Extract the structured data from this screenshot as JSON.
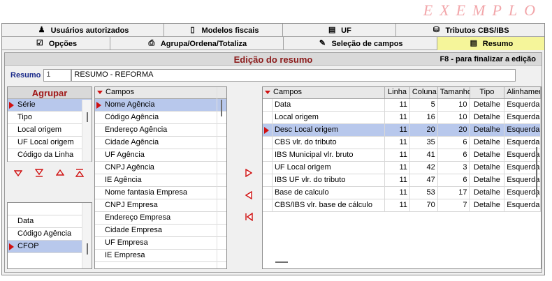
{
  "watermark": "EXEMPLO",
  "tabs_row1": [
    {
      "label": "Usuários autorizados",
      "icon": "♟"
    },
    {
      "label": "Modelos fiscais",
      "icon": "▯"
    },
    {
      "label": "UF",
      "icon": "▤"
    },
    {
      "label": "Tributos CBS/IBS",
      "icon": "⛁"
    }
  ],
  "tabs_row2": [
    {
      "label": "Opções",
      "icon": "☑"
    },
    {
      "label": "Agrupa/Ordena/Totaliza",
      "icon": "⎙"
    },
    {
      "label": "Seleção de campos",
      "icon": "✎"
    },
    {
      "label": "Resumo",
      "icon": "▤"
    }
  ],
  "title": "Edição do resumo",
  "f8_hint": "F8 - para finalizar a edição",
  "resumo": {
    "label": "Resumo",
    "number": "1",
    "name": "RESUMO - REFORMA"
  },
  "agrupar": {
    "title": "Agrupar",
    "items": [
      "Série",
      "Tipo",
      "Local origem",
      "UF Local origem",
      "Código da Linha"
    ],
    "selected": 0
  },
  "order_items": {
    "items": [
      "Data",
      "Código Agência",
      "CFOP"
    ],
    "selected": 2
  },
  "campos": {
    "header": "Campos",
    "items": [
      "Nome Agência",
      "Código Agência",
      "Endereço Agência",
      "Cidade Agência",
      "UF Agência",
      "CNPJ Agência",
      "IE Agência",
      "Nome fantasia Empresa",
      "CNPJ Empresa",
      "Endereço Empresa",
      "Cidade Empresa",
      "UF Empresa",
      "IE Empresa"
    ],
    "selected": 0
  },
  "grid": {
    "headers": [
      "Campos",
      "Linha",
      "Coluna",
      "Tamanho",
      "Tipo",
      "Alinhamento"
    ],
    "rows": [
      [
        "Data",
        "11",
        "5",
        "10",
        "Detalhe",
        "Esquerda"
      ],
      [
        "Local origem",
        "11",
        "16",
        "10",
        "Detalhe",
        "Esquerda"
      ],
      [
        "Desc Local origem",
        "11",
        "20",
        "20",
        "Detalhe",
        "Esquerda"
      ],
      [
        "CBS vlr. do tributo",
        "11",
        "35",
        "6",
        "Detalhe",
        "Esquerda"
      ],
      [
        "IBS Municipal vlr. bruto",
        "11",
        "41",
        "6",
        "Detalhe",
        "Esquerda"
      ],
      [
        "UF Local origem",
        "11",
        "42",
        "3",
        "Detalhe",
        "Esquerda"
      ],
      [
        "IBS UF vlr. do tributo",
        "11",
        "47",
        "6",
        "Detalhe",
        "Esquerda"
      ],
      [
        "Base de calculo",
        "11",
        "53",
        "17",
        "Detalhe",
        "Esquerda"
      ],
      [
        "CBS/IBS vlr. base de cálculo",
        "11",
        "70",
        "7",
        "Detalhe",
        "Esquerda"
      ]
    ],
    "selected": 2
  }
}
